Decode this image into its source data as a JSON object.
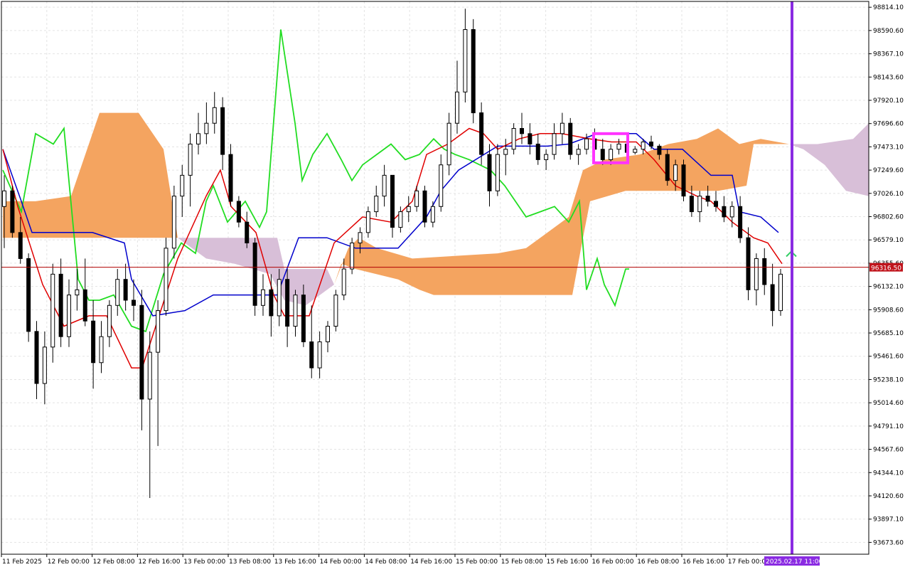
{
  "chart_data": {
    "type": "candlestick",
    "indicator": "Ichimoku Kinko Hyo",
    "y_ticks": [
      "98814.10",
      "98590.60",
      "98367.10",
      "98143.60",
      "97920.10",
      "97696.60",
      "97473.10",
      "97249.60",
      "97026.10",
      "96802.60",
      "96579.10",
      "96355.60",
      "96132.10",
      "95908.60",
      "95685.10",
      "95461.60",
      "95238.10",
      "95014.60",
      "94791.10",
      "94567.60",
      "94344.10",
      "94120.60",
      "93897.10",
      "93673.60"
    ],
    "x_ticks": [
      "11 Feb 2025",
      "12 Feb 00:00",
      "12 Feb 08:00",
      "12 Feb 16:00",
      "13 Feb 00:00",
      "13 Feb 08:00",
      "13 Feb 16:00",
      "14 Feb 00:00",
      "14 Feb 08:00",
      "14 Feb 16:00",
      "15 Feb 00:00",
      "15 Feb 08:00",
      "15 Feb 16:00",
      "16 Feb 00:00",
      "16 Feb 08:00",
      "16 Feb 16:00",
      "17 Feb 00:00"
    ],
    "current_price": "96316.50",
    "cursor_time_label": "2025.02.17 11:00",
    "ylim": [
      93560,
      98870
    ],
    "colors": {
      "tenkan": "#e00000",
      "kijun": "#0000cc",
      "chikou": "#22dd22",
      "kumo_bull": "#f4a460",
      "kumo_bear": "#d8bfd8",
      "price_line": "#b00000",
      "price_tag": "#c0141c",
      "vline": "#8a2be2",
      "highlight": "#ff33ff",
      "arrow": "#33cc66",
      "grid": "#e3e3e3"
    },
    "candles_ohlc": [
      [
        96900,
        97200,
        96500,
        97050
      ],
      [
        97050,
        97100,
        96600,
        96650
      ],
      [
        96650,
        96800,
        96350,
        96400
      ],
      [
        96400,
        96450,
        95600,
        95700
      ],
      [
        95700,
        95800,
        95050,
        95200
      ],
      [
        95200,
        95700,
        95000,
        95550
      ],
      [
        95550,
        96350,
        95400,
        96250
      ],
      [
        96250,
        96400,
        95550,
        95650
      ],
      [
        95650,
        96200,
        95550,
        96050
      ],
      [
        96050,
        96300,
        95900,
        96100
      ],
      [
        96100,
        96400,
        95750,
        95800
      ],
      [
        95800,
        96000,
        95150,
        95400
      ],
      [
        95400,
        95800,
        95300,
        95650
      ],
      [
        95650,
        96000,
        95550,
        95950
      ],
      [
        95950,
        96300,
        95850,
        96200
      ],
      [
        96200,
        96350,
        95900,
        96000
      ],
      [
        96000,
        96200,
        95800,
        95950
      ],
      [
        95950,
        96100,
        94750,
        95050
      ],
      [
        95050,
        95700,
        94100,
        95500
      ],
      [
        95500,
        96000,
        94600,
        95900
      ],
      [
        95900,
        96600,
        95850,
        96500
      ],
      [
        96500,
        97100,
        96400,
        97000
      ],
      [
        97000,
        97300,
        96800,
        97200
      ],
      [
        97200,
        97600,
        96900,
        97500
      ],
      [
        97500,
        97800,
        97400,
        97600
      ],
      [
        97600,
        97900,
        97500,
        97700
      ],
      [
        97700,
        98000,
        97600,
        97850
      ],
      [
        97850,
        97950,
        97250,
        97400
      ],
      [
        97400,
        97500,
        96900,
        96950
      ],
      [
        96950,
        97000,
        96700,
        96750
      ],
      [
        96750,
        96850,
        96500,
        96550
      ],
      [
        96550,
        96600,
        95850,
        95950
      ],
      [
        95950,
        96250,
        95850,
        96100
      ],
      [
        96100,
        96250,
        95650,
        95850
      ],
      [
        95850,
        96300,
        95750,
        96200
      ],
      [
        96200,
        96300,
        95550,
        95750
      ],
      [
        95750,
        96100,
        95650,
        96050
      ],
      [
        96050,
        96150,
        95550,
        95600
      ],
      [
        95600,
        95950,
        95250,
        95350
      ],
      [
        95350,
        95700,
        95250,
        95600
      ],
      [
        95600,
        95800,
        95500,
        95750
      ],
      [
        95750,
        96100,
        95700,
        96050
      ],
      [
        96050,
        96400,
        96000,
        96300
      ],
      [
        96300,
        96600,
        96250,
        96550
      ],
      [
        96550,
        96700,
        96450,
        96650
      ],
      [
        96650,
        96900,
        96600,
        96850
      ],
      [
        96850,
        97100,
        96800,
        97000
      ],
      [
        97000,
        97300,
        96900,
        97200
      ],
      [
        97200,
        97100,
        96600,
        96700
      ],
      [
        96700,
        96900,
        96650,
        96850
      ],
      [
        96850,
        97000,
        96750,
        96900
      ],
      [
        96900,
        97100,
        96850,
        97050
      ],
      [
        97050,
        97100,
        96700,
        96750
      ],
      [
        96750,
        96950,
        96700,
        96900
      ],
      [
        96900,
        97400,
        96850,
        97300
      ],
      [
        97300,
        97800,
        97200,
        97700
      ],
      [
        97700,
        98300,
        97600,
        98000
      ],
      [
        98000,
        98800,
        97900,
        98600
      ],
      [
        98600,
        98700,
        97700,
        97800
      ],
      [
        97800,
        97900,
        97300,
        97400
      ],
      [
        97400,
        97500,
        96900,
        97050
      ],
      [
        97050,
        97500,
        97000,
        97400
      ],
      [
        97400,
        97550,
        97200,
        97450
      ],
      [
        97450,
        97700,
        97400,
        97650
      ],
      [
        97650,
        97800,
        97500,
        97600
      ],
      [
        97600,
        97700,
        97400,
        97500
      ],
      [
        97500,
        97600,
        97300,
        97350
      ],
      [
        97350,
        97450,
        97250,
        97400
      ],
      [
        97400,
        97700,
        97350,
        97600
      ],
      [
        97600,
        97800,
        97500,
        97700
      ],
      [
        97700,
        97750,
        97350,
        97400
      ],
      [
        97400,
        97500,
        97300,
        97450
      ],
      [
        97450,
        97600,
        97400,
        97550
      ],
      [
        97550,
        97650,
        97400,
        97450
      ],
      [
        97450,
        97550,
        97300,
        97350
      ],
      [
        97350,
        97500,
        97300,
        97450
      ],
      [
        97450,
        97550,
        97400,
        97500
      ],
      [
        97500,
        97550,
        97400,
        97420
      ],
      [
        97420,
        97480,
        97400,
        97450
      ],
      [
        97450,
        97550,
        97400,
        97520
      ],
      [
        97520,
        97580,
        97450,
        97480
      ],
      [
        97480,
        97500,
        97350,
        97400
      ],
      [
        97400,
        97450,
        97100,
        97150
      ],
      [
        97150,
        97350,
        97050,
        97300
      ],
      [
        97300,
        97350,
        96950,
        97000
      ],
      [
        97000,
        97100,
        96800,
        96850
      ],
      [
        96850,
        97050,
        96750,
        97000
      ],
      [
        97000,
        97100,
        96900,
        96950
      ],
      [
        96950,
        97050,
        96850,
        96900
      ],
      [
        96900,
        97000,
        96750,
        96800
      ],
      [
        96800,
        96950,
        96700,
        96900
      ],
      [
        96900,
        97000,
        96550,
        96600
      ],
      [
        96600,
        96700,
        96000,
        96100
      ],
      [
        96100,
        96450,
        95950,
        96400
      ],
      [
        96400,
        96500,
        96050,
        96150
      ],
      [
        96150,
        96350,
        95750,
        95900
      ],
      [
        95900,
        96300,
        95850,
        96250
      ]
    ],
    "tenkan": [
      [
        4,
        97450
      ],
      [
        25,
        96900
      ],
      [
        60,
        96150
      ],
      [
        90,
        95750
      ],
      [
        125,
        95850
      ],
      [
        150,
        95850
      ],
      [
        185,
        95350
      ],
      [
        200,
        95350
      ],
      [
        250,
        96400
      ],
      [
        290,
        97000
      ],
      [
        310,
        97250
      ],
      [
        325,
        96900
      ],
      [
        360,
        96650
      ],
      [
        385,
        96050
      ],
      [
        400,
        95850
      ],
      [
        435,
        95850
      ],
      [
        470,
        96550
      ],
      [
        510,
        96800
      ],
      [
        550,
        96750
      ],
      [
        580,
        96950
      ],
      [
        600,
        97400
      ],
      [
        630,
        97500
      ],
      [
        660,
        97650
      ],
      [
        680,
        97600
      ],
      [
        700,
        97450
      ],
      [
        730,
        97550
      ],
      [
        760,
        97600
      ],
      [
        790,
        97600
      ],
      [
        830,
        97550
      ],
      [
        860,
        97520
      ],
      [
        895,
        97520
      ],
      [
        920,
        97350
      ],
      [
        950,
        97100
      ],
      [
        980,
        97000
      ],
      [
        1000,
        96950
      ],
      [
        1030,
        96750
      ],
      [
        1060,
        96600
      ],
      [
        1080,
        96550
      ],
      [
        1100,
        96350
      ]
    ],
    "kijun": [
      [
        4,
        97450
      ],
      [
        30,
        96950
      ],
      [
        45,
        96650
      ],
      [
        130,
        96650
      ],
      [
        175,
        96550
      ],
      [
        185,
        96200
      ],
      [
        215,
        95850
      ],
      [
        260,
        95900
      ],
      [
        300,
        96050
      ],
      [
        330,
        96050
      ],
      [
        390,
        96050
      ],
      [
        420,
        96600
      ],
      [
        460,
        96600
      ],
      [
        500,
        96500
      ],
      [
        560,
        96500
      ],
      [
        600,
        96800
      ],
      [
        620,
        97050
      ],
      [
        645,
        97250
      ],
      [
        700,
        97480
      ],
      [
        740,
        97480
      ],
      [
        770,
        97480
      ],
      [
        800,
        97500
      ],
      [
        840,
        97600
      ],
      [
        870,
        97600
      ],
      [
        895,
        97600
      ],
      [
        920,
        97450
      ],
      [
        960,
        97450
      ],
      [
        1000,
        97200
      ],
      [
        1030,
        97200
      ],
      [
        1040,
        96850
      ],
      [
        1070,
        96800
      ],
      [
        1095,
        96650
      ]
    ],
    "chikou": [
      [
        4,
        97250
      ],
      [
        30,
        96850
      ],
      [
        50,
        97600
      ],
      [
        75,
        97500
      ],
      [
        90,
        97650
      ],
      [
        110,
        96200
      ],
      [
        125,
        96000
      ],
      [
        140,
        96000
      ],
      [
        160,
        96050
      ],
      [
        185,
        95750
      ],
      [
        205,
        95700
      ],
      [
        230,
        96250
      ],
      [
        255,
        96550
      ],
      [
        275,
        96450
      ],
      [
        290,
        96950
      ],
      [
        300,
        97100
      ],
      [
        320,
        96750
      ],
      [
        345,
        96950
      ],
      [
        365,
        96700
      ],
      [
        375,
        96850
      ],
      [
        395,
        98600
      ],
      [
        415,
        97700
      ],
      [
        425,
        97150
      ],
      [
        440,
        97400
      ],
      [
        460,
        97600
      ],
      [
        480,
        97350
      ],
      [
        495,
        97150
      ],
      [
        510,
        97300
      ],
      [
        530,
        97400
      ],
      [
        550,
        97500
      ],
      [
        570,
        97350
      ],
      [
        590,
        97400
      ],
      [
        610,
        97550
      ],
      [
        625,
        97450
      ],
      [
        640,
        97400
      ],
      [
        660,
        97350
      ],
      [
        690,
        97250
      ],
      [
        710,
        97100
      ],
      [
        740,
        96800
      ],
      [
        760,
        96850
      ],
      [
        780,
        96900
      ],
      [
        800,
        96750
      ],
      [
        815,
        96950
      ],
      [
        825,
        96100
      ],
      [
        840,
        96400
      ],
      [
        850,
        96150
      ],
      [
        865,
        95950
      ],
      [
        880,
        96300
      ],
      [
        885,
        96300
      ]
    ],
    "kumo_bull_upper": [
      [
        4,
        96950
      ],
      [
        50,
        96950
      ],
      [
        100,
        97000
      ],
      [
        140,
        97800
      ],
      [
        195,
        97800
      ],
      [
        230,
        97450
      ],
      [
        250,
        96600
      ]
    ],
    "kumo_bull_lower": [
      [
        250,
        96600
      ],
      [
        4,
        96600
      ]
    ],
    "kumo_bear_upper": [
      [
        250,
        96600
      ],
      [
        300,
        96600
      ],
      [
        360,
        96600
      ],
      [
        390,
        96600
      ],
      [
        400,
        96300
      ],
      [
        460,
        96300
      ],
      [
        470,
        96150
      ]
    ],
    "kumo_bear_lower": [
      [
        470,
        96150
      ],
      [
        430,
        95950
      ],
      [
        400,
        96000
      ],
      [
        380,
        96250
      ],
      [
        330,
        96350
      ],
      [
        290,
        96400
      ],
      [
        250,
        96600
      ]
    ],
    "kumo_bull2_upper": [
      [
        470,
        96150
      ],
      [
        490,
        96500
      ],
      [
        505,
        96600
      ],
      [
        530,
        96500
      ],
      [
        580,
        96400
      ],
      [
        700,
        96450
      ],
      [
        740,
        96500
      ],
      [
        800,
        96800
      ],
      [
        820,
        97250
      ],
      [
        850,
        97350
      ],
      [
        900,
        97400
      ],
      [
        940,
        97500
      ],
      [
        980,
        97550
      ],
      [
        1010,
        97650
      ],
      [
        1040,
        97500
      ],
      [
        1070,
        97550
      ],
      [
        1110,
        97500
      ]
    ],
    "kumo_bull2_lower": [
      [
        1110,
        97500
      ],
      [
        1060,
        97500
      ],
      [
        1050,
        97100
      ],
      [
        1010,
        97050
      ],
      [
        940,
        97050
      ],
      [
        880,
        97050
      ],
      [
        830,
        96950
      ],
      [
        820,
        96600
      ],
      [
        805,
        96050
      ],
      [
        700,
        96050
      ],
      [
        610,
        96050
      ],
      [
        590,
        96100
      ],
      [
        560,
        96200
      ],
      [
        500,
        96300
      ],
      [
        480,
        96350
      ],
      [
        470,
        96150
      ]
    ],
    "kumo_future_upper": [
      [
        1110,
        97500
      ],
      [
        1150,
        97500
      ],
      [
        1200,
        97550
      ],
      [
        1222,
        97700
      ]
    ],
    "kumo_future_lower": [
      [
        1222,
        97000
      ],
      [
        1190,
        97050
      ],
      [
        1160,
        97300
      ],
      [
        1130,
        97450
      ],
      [
        1110,
        97500
      ]
    ]
  }
}
